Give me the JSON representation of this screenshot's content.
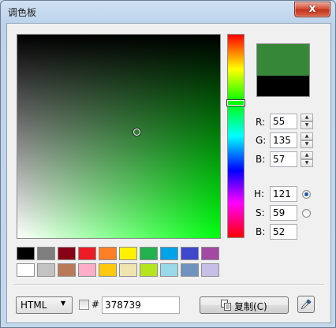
{
  "window": {
    "title": "调色板",
    "close_glyph": "x"
  },
  "picker": {
    "hue_color": "#00ff10",
    "new_color": "#378739",
    "old_color": "#000000"
  },
  "rgb": {
    "r_label": "R:",
    "r_value": "55",
    "g_label": "G:",
    "g_value": "135",
    "b_label": "B:",
    "b_value": "57"
  },
  "hsb": {
    "h_label": "H:",
    "h_value": "121",
    "s_label": "S:",
    "s_value": "59",
    "b_label": "B:",
    "b_value": "52",
    "selected_mode": "H"
  },
  "swatches": {
    "row1": [
      "#000000",
      "#7f7f7f",
      "#880015",
      "#ed1c24",
      "#ff7f27",
      "#fff200",
      "#22b14c",
      "#00a2e8",
      "#3f48cc",
      "#a349a4"
    ],
    "row2": [
      "#ffffff",
      "#c3c3c3",
      "#b97a57",
      "#ffaec9",
      "#ffc90e",
      "#efe4b0",
      "#b5e61d",
      "#99d9ea",
      "#7092be",
      "#c8bfe7"
    ]
  },
  "footer": {
    "format_value": "HTML",
    "hash_label": "#",
    "hex_value": "378739",
    "copy_icon": "copy-icon",
    "copy_label": "复制(C)",
    "eyedropper_icon": "eyedropper-icon"
  }
}
